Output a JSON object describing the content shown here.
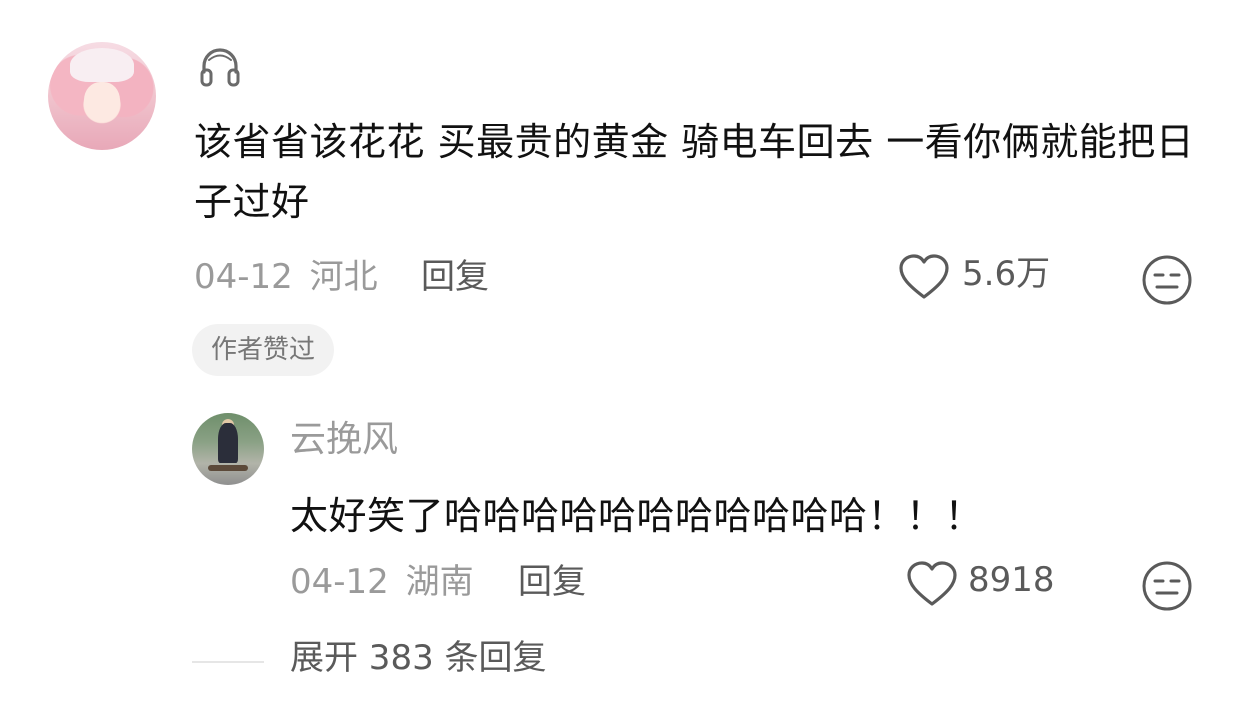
{
  "comment": {
    "text": "该省省该花花 买最贵的黄金 骑电车回去 一看你俩就能把日子过好",
    "date": "04-12",
    "location": "河北",
    "reply_label": "回复",
    "like_count": "5.6万",
    "author_liked_label": "作者赞过",
    "badge_icon": "headphones-icon"
  },
  "reply": {
    "username": "云挽风",
    "text": "太好笑了哈哈哈哈哈哈哈哈哈哈哈！！！",
    "date": "04-12",
    "location": "湖南",
    "reply_label": "回复",
    "like_count": "8918"
  },
  "expand": {
    "label": "展开 383 条回复"
  }
}
